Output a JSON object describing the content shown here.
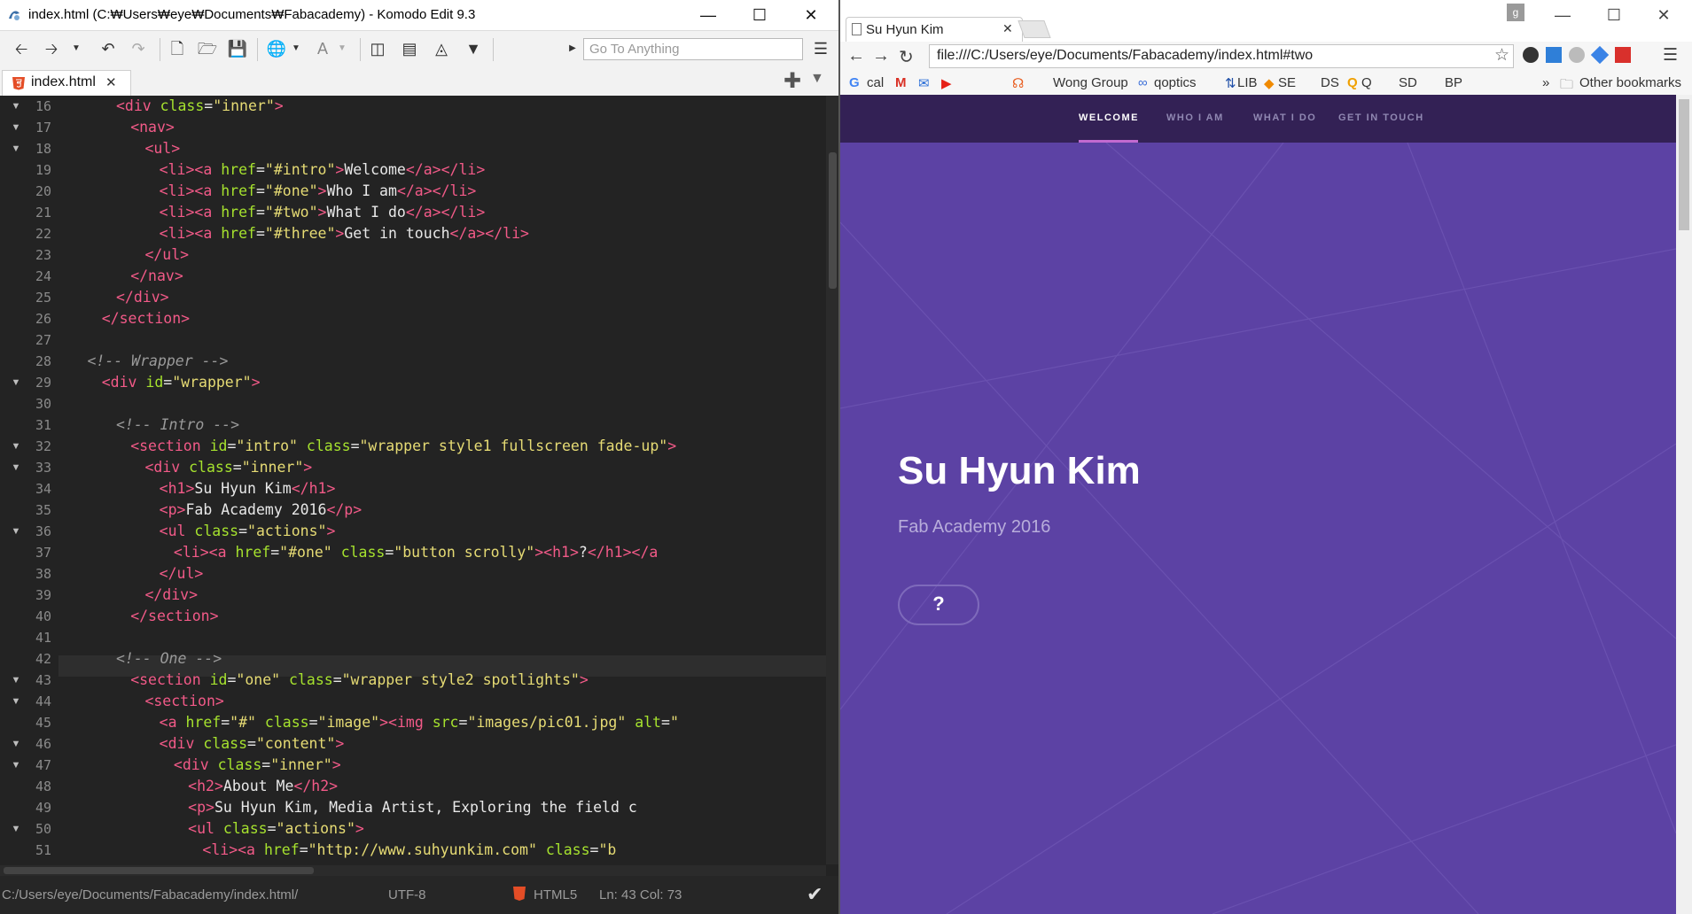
{
  "komodo": {
    "window_title": "index.html (C:₩Users₩eye₩Documents₩Fabacademy) - Komodo Edit 9.3",
    "goto_placeholder": "Go To Anything",
    "tab_label": "index.html",
    "tab_close": "✕",
    "status": {
      "path": "C:/Users/eye/Documents/Fabacademy/index.html/",
      "encoding": "UTF-8",
      "language": "HTML5",
      "position": "Ln: 43 Col: 73"
    },
    "lines": [
      {
        "n": "16",
        "fold": true,
        "ind": 8,
        "parts": [
          [
            "tag",
            "<div "
          ],
          [
            "attr",
            "class"
          ],
          [
            "plain",
            "="
          ],
          [
            "str",
            "\"inner\""
          ],
          [
            "tag",
            ">"
          ]
        ]
      },
      {
        "n": "17",
        "fold": true,
        "ind": 10,
        "parts": [
          [
            "tag",
            "<nav>"
          ]
        ]
      },
      {
        "n": "18",
        "fold": true,
        "ind": 12,
        "parts": [
          [
            "tag",
            "<ul>"
          ]
        ]
      },
      {
        "n": "19",
        "fold": false,
        "ind": 14,
        "parts": [
          [
            "tag",
            "<li><a "
          ],
          [
            "attr",
            "href"
          ],
          [
            "plain",
            "="
          ],
          [
            "str",
            "\"#intro\""
          ],
          [
            "tag",
            ">"
          ],
          [
            "plain",
            "Welcome"
          ],
          [
            "tag",
            "</a></li>"
          ]
        ]
      },
      {
        "n": "20",
        "fold": false,
        "ind": 14,
        "parts": [
          [
            "tag",
            "<li><a "
          ],
          [
            "attr",
            "href"
          ],
          [
            "plain",
            "="
          ],
          [
            "str",
            "\"#one\""
          ],
          [
            "tag",
            ">"
          ],
          [
            "plain",
            "Who I am"
          ],
          [
            "tag",
            "</a></li>"
          ]
        ]
      },
      {
        "n": "21",
        "fold": false,
        "ind": 14,
        "parts": [
          [
            "tag",
            "<li><a "
          ],
          [
            "attr",
            "href"
          ],
          [
            "plain",
            "="
          ],
          [
            "str",
            "\"#two\""
          ],
          [
            "tag",
            ">"
          ],
          [
            "plain",
            "What I do"
          ],
          [
            "tag",
            "</a></li>"
          ]
        ]
      },
      {
        "n": "22",
        "fold": false,
        "ind": 14,
        "parts": [
          [
            "tag",
            "<li><a "
          ],
          [
            "attr",
            "href"
          ],
          [
            "plain",
            "="
          ],
          [
            "str",
            "\"#three\""
          ],
          [
            "tag",
            ">"
          ],
          [
            "plain",
            "Get in touch"
          ],
          [
            "tag",
            "</a></li>"
          ]
        ]
      },
      {
        "n": "23",
        "fold": false,
        "ind": 12,
        "parts": [
          [
            "tag",
            "</ul>"
          ]
        ]
      },
      {
        "n": "24",
        "fold": false,
        "ind": 10,
        "parts": [
          [
            "tag",
            "</nav>"
          ]
        ]
      },
      {
        "n": "25",
        "fold": false,
        "ind": 8,
        "parts": [
          [
            "tag",
            "</div>"
          ]
        ]
      },
      {
        "n": "26",
        "fold": false,
        "ind": 6,
        "parts": [
          [
            "tag",
            "</section>"
          ]
        ]
      },
      {
        "n": "27",
        "fold": false,
        "ind": 0,
        "parts": []
      },
      {
        "n": "28",
        "fold": false,
        "ind": 4,
        "parts": [
          [
            "cmt",
            "<!-- Wrapper -->"
          ]
        ]
      },
      {
        "n": "29",
        "fold": true,
        "ind": 6,
        "parts": [
          [
            "tag",
            "<div "
          ],
          [
            "attr",
            "id"
          ],
          [
            "plain",
            "="
          ],
          [
            "str",
            "\"wrapper\""
          ],
          [
            "tag",
            ">"
          ]
        ]
      },
      {
        "n": "30",
        "fold": false,
        "ind": 0,
        "parts": []
      },
      {
        "n": "31",
        "fold": false,
        "ind": 8,
        "parts": [
          [
            "cmt",
            "<!-- Intro -->"
          ]
        ]
      },
      {
        "n": "32",
        "fold": true,
        "ind": 10,
        "parts": [
          [
            "tag",
            "<section "
          ],
          [
            "attr",
            "id"
          ],
          [
            "plain",
            "="
          ],
          [
            "str",
            "\"intro\""
          ],
          [
            "plain",
            " "
          ],
          [
            "attr",
            "class"
          ],
          [
            "plain",
            "="
          ],
          [
            "str",
            "\"wrapper style1 fullscreen fade-up\""
          ],
          [
            "tag",
            ">"
          ]
        ]
      },
      {
        "n": "33",
        "fold": true,
        "ind": 12,
        "parts": [
          [
            "tag",
            "<div "
          ],
          [
            "attr",
            "class"
          ],
          [
            "plain",
            "="
          ],
          [
            "str",
            "\"inner\""
          ],
          [
            "tag",
            ">"
          ]
        ]
      },
      {
        "n": "34",
        "fold": false,
        "ind": 14,
        "parts": [
          [
            "tag",
            "<h1>"
          ],
          [
            "plain",
            "Su Hyun Kim"
          ],
          [
            "tag",
            "</h1>"
          ]
        ]
      },
      {
        "n": "35",
        "fold": false,
        "ind": 14,
        "parts": [
          [
            "tag",
            "<p>"
          ],
          [
            "plain",
            "Fab Academy 2016"
          ],
          [
            "tag",
            "</p>"
          ]
        ]
      },
      {
        "n": "36",
        "fold": true,
        "ind": 14,
        "parts": [
          [
            "tag",
            "<ul "
          ],
          [
            "attr",
            "class"
          ],
          [
            "plain",
            "="
          ],
          [
            "str",
            "\"actions\""
          ],
          [
            "tag",
            ">"
          ]
        ]
      },
      {
        "n": "37",
        "fold": false,
        "ind": 16,
        "parts": [
          [
            "tag",
            "<li><a "
          ],
          [
            "attr",
            "href"
          ],
          [
            "plain",
            "="
          ],
          [
            "str",
            "\"#one\""
          ],
          [
            "plain",
            " "
          ],
          [
            "attr",
            "class"
          ],
          [
            "plain",
            "="
          ],
          [
            "str",
            "\"button scrolly\""
          ],
          [
            "tag",
            "><h1>"
          ],
          [
            "plain",
            "?"
          ],
          [
            "tag",
            "</h1></a"
          ]
        ]
      },
      {
        "n": "38",
        "fold": false,
        "ind": 14,
        "parts": [
          [
            "tag",
            "</ul>"
          ]
        ]
      },
      {
        "n": "39",
        "fold": false,
        "ind": 12,
        "parts": [
          [
            "tag",
            "</div>"
          ]
        ]
      },
      {
        "n": "40",
        "fold": false,
        "ind": 10,
        "parts": [
          [
            "tag",
            "</section>"
          ]
        ]
      },
      {
        "n": "41",
        "fold": false,
        "ind": 0,
        "parts": []
      },
      {
        "n": "42",
        "fold": false,
        "ind": 8,
        "parts": [
          [
            "cmt",
            "<!-- One -->"
          ]
        ]
      },
      {
        "n": "43",
        "fold": true,
        "ind": 10,
        "parts": [
          [
            "tag",
            "<section "
          ],
          [
            "attr",
            "id"
          ],
          [
            "plain",
            "="
          ],
          [
            "str",
            "\"one\""
          ],
          [
            "plain",
            " "
          ],
          [
            "attr",
            "class"
          ],
          [
            "plain",
            "="
          ],
          [
            "str",
            "\"wrapper style2 spotlights\""
          ],
          [
            "tag",
            ">"
          ]
        ]
      },
      {
        "n": "44",
        "fold": true,
        "ind": 12,
        "parts": [
          [
            "tag",
            "<section>"
          ]
        ]
      },
      {
        "n": "45",
        "fold": false,
        "ind": 14,
        "parts": [
          [
            "tag",
            "<a "
          ],
          [
            "attr",
            "href"
          ],
          [
            "plain",
            "="
          ],
          [
            "str",
            "\"#\""
          ],
          [
            "plain",
            " "
          ],
          [
            "attr",
            "class"
          ],
          [
            "plain",
            "="
          ],
          [
            "str",
            "\"image\""
          ],
          [
            "tag",
            "><img "
          ],
          [
            "attr",
            "src"
          ],
          [
            "plain",
            "="
          ],
          [
            "str",
            "\"images/pic01.jpg\""
          ],
          [
            "plain",
            " "
          ],
          [
            "attr",
            "alt"
          ],
          [
            "plain",
            "="
          ],
          [
            "str",
            "\""
          ]
        ]
      },
      {
        "n": "46",
        "fold": true,
        "ind": 14,
        "parts": [
          [
            "tag",
            "<div "
          ],
          [
            "attr",
            "class"
          ],
          [
            "plain",
            "="
          ],
          [
            "str",
            "\"content\""
          ],
          [
            "tag",
            ">"
          ]
        ]
      },
      {
        "n": "47",
        "fold": true,
        "ind": 16,
        "parts": [
          [
            "tag",
            "<div "
          ],
          [
            "attr",
            "class"
          ],
          [
            "plain",
            "="
          ],
          [
            "str",
            "\"inner\""
          ],
          [
            "tag",
            ">"
          ]
        ]
      },
      {
        "n": "48",
        "fold": false,
        "ind": 18,
        "parts": [
          [
            "tag",
            "<h2>"
          ],
          [
            "plain",
            "About Me"
          ],
          [
            "tag",
            "</h2>"
          ]
        ]
      },
      {
        "n": "49",
        "fold": false,
        "ind": 18,
        "parts": [
          [
            "tag",
            "<p>"
          ],
          [
            "plain",
            "Su Hyun Kim, Media Artist, Exploring the field c"
          ]
        ]
      },
      {
        "n": "50",
        "fold": true,
        "ind": 18,
        "parts": [
          [
            "tag",
            "<ul "
          ],
          [
            "attr",
            "class"
          ],
          [
            "plain",
            "="
          ],
          [
            "str",
            "\"actions\""
          ],
          [
            "tag",
            ">"
          ]
        ]
      },
      {
        "n": "51",
        "fold": false,
        "ind": 20,
        "parts": [
          [
            "tag",
            "<li><a "
          ],
          [
            "attr",
            "href"
          ],
          [
            "plain",
            "="
          ],
          [
            "str",
            "\"http://www.suhyunkim.com\""
          ],
          [
            "plain",
            " "
          ],
          [
            "attr",
            "class"
          ],
          [
            "plain",
            "="
          ],
          [
            "str",
            "\"b"
          ]
        ]
      }
    ]
  },
  "chrome": {
    "tab_title": "Su Hyun Kim",
    "address": "file:///C:/Users/eye/Documents/Fabacademy/index.html#two",
    "bookmarks": [
      "cal",
      "Wong Group",
      "qoptics",
      "LIB",
      "SE",
      "DS",
      "Q",
      "SD",
      "BP"
    ],
    "other_bookmarks": "Other bookmarks",
    "more_bookmarks": "»",
    "page": {
      "nav": [
        "WELCOME",
        "WHO I AM",
        "WHAT I DO",
        "GET IN TOUCH"
      ],
      "title": "Su Hyun Kim",
      "subtitle": "Fab Academy 2016",
      "button_label": "?"
    }
  }
}
